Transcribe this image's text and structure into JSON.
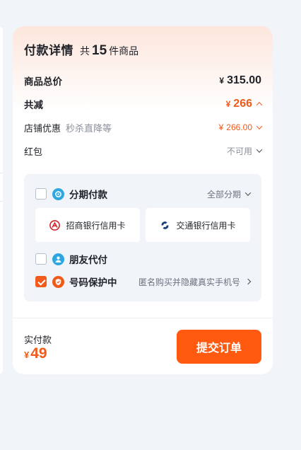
{
  "colors": {
    "accent": "#f05a1a",
    "button": "#ff5a0f",
    "page_bg": "#f1f4f8",
    "card_bg": "#ffffff"
  },
  "header": {
    "title": "付款详情",
    "count_prefix": "共",
    "count": "15",
    "count_suffix": "件商品"
  },
  "summary": {
    "total_label": "商品总价",
    "total_currency": "¥",
    "total_value": "315.00",
    "discount_label": "共减",
    "discount_currency": "¥",
    "discount_value": "266",
    "shop_discount_label": "店铺优惠",
    "shop_discount_sub": "秒杀直降等",
    "shop_discount_currency": "¥",
    "shop_discount_value": "266.00",
    "red_packet_label": "红包",
    "red_packet_value": "不可用"
  },
  "payment": {
    "installment": {
      "label": "分期付款",
      "right": "全部分期",
      "checked": false,
      "icon": "installment-icon"
    },
    "banks": [
      {
        "label": "招商银行信用卡",
        "icon": "cmb-logo-icon"
      },
      {
        "label": "交通银行信用卡",
        "icon": "bocom-logo-icon"
      }
    ],
    "friend_pay": {
      "label": "朋友代付",
      "checked": false,
      "icon": "friend-icon"
    },
    "number_protection": {
      "label": "号码保护中",
      "right": "匿名购买并隐藏真实手机号",
      "checked": true,
      "icon": "shield-icon"
    }
  },
  "footer": {
    "paid_label": "实付款",
    "paid_currency": "¥",
    "paid_value": "49",
    "submit_label": "提交订单"
  }
}
